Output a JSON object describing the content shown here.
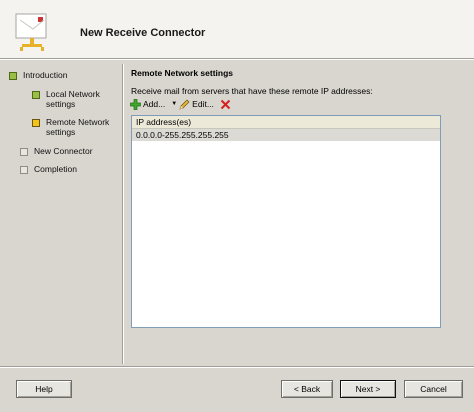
{
  "header": {
    "title": "New Receive Connector"
  },
  "nav": [
    {
      "label_lines": [
        "Introduction"
      ],
      "status": "green"
    },
    {
      "label_lines": [
        "Local Network",
        "settings"
      ],
      "status": "green"
    },
    {
      "label_lines": [
        "Remote Network",
        "settings"
      ],
      "status": "yellow"
    },
    {
      "label_lines": [
        "New Connector"
      ],
      "status": "gray"
    },
    {
      "label_lines": [
        "Completion"
      ],
      "status": "gray"
    }
  ],
  "main": {
    "section_title": "Remote Network settings",
    "description": "Receive mail from servers that have these remote IP addresses:",
    "toolbar": {
      "add_label": "Add...",
      "edit_label": "Edit...",
      "add_icon": "plus-icon",
      "edit_icon": "pencil-icon",
      "delete_icon": "delete-x-icon",
      "dropdown_icon": "dropdown-arrow-icon"
    },
    "table": {
      "header": "IP address(es)",
      "rows": [
        "0.0.0.0-255.255.255.255"
      ]
    }
  },
  "footer": {
    "help": "Help",
    "back": "< Back",
    "next": "Next >",
    "cancel": "Cancel"
  },
  "colors": {
    "status_green": "#9bbf45",
    "status_yellow": "#f0c419",
    "delete_red": "#d42020",
    "add_green": "#3fa82c"
  }
}
